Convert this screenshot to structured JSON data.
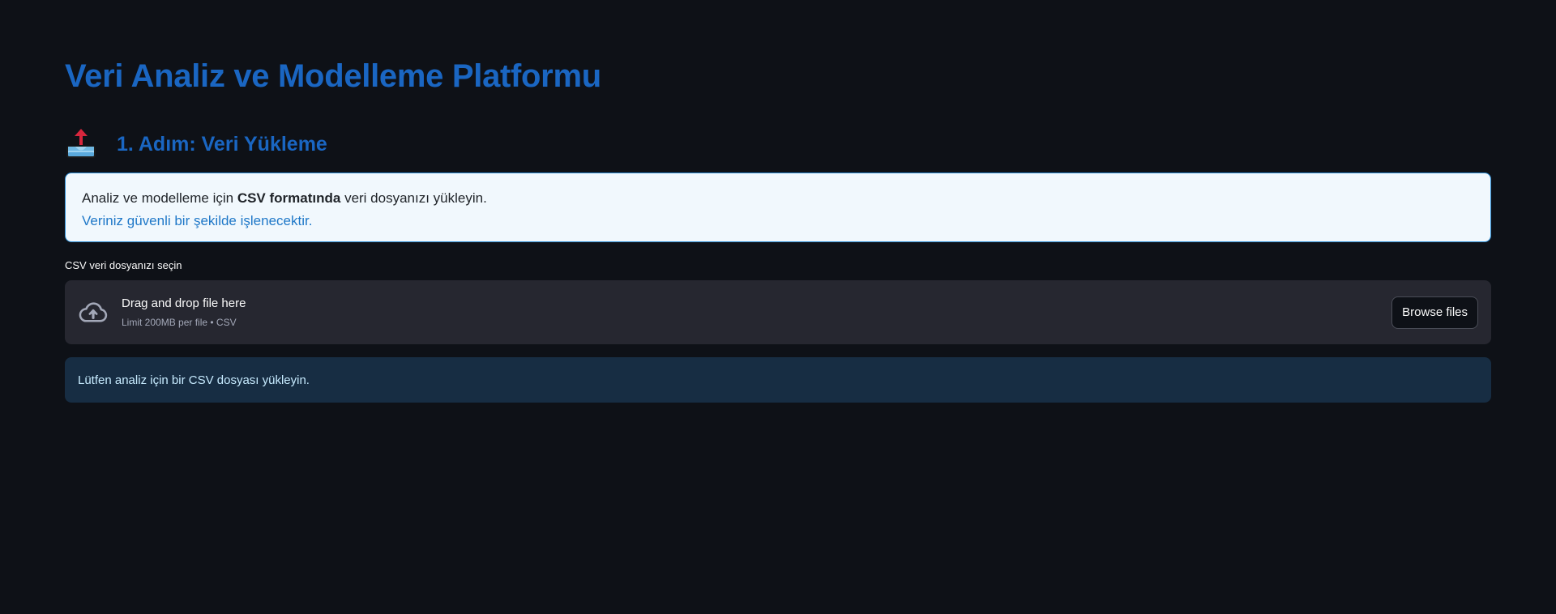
{
  "header": {
    "title": "Veri Analiz ve Modelleme Platformu"
  },
  "step1": {
    "icon": "inbox-upload-icon",
    "title": "1. Adım: Veri Yükleme"
  },
  "info_card": {
    "line1_prefix": "Analiz ve modelleme için ",
    "line1_bold": "CSV formatında",
    "line1_suffix": " veri dosyanızı yükleyin.",
    "line2": "Veriniz güvenli bir şekilde işlenecektir."
  },
  "uploader": {
    "label": "CSV veri dosyanızı seçin",
    "icon": "cloud-upload-icon",
    "drop_text": "Drag and drop file here",
    "limit_text": "Limit 200MB per file • CSV",
    "button_label": "Browse files"
  },
  "alert": {
    "message": "Lütfen analiz için bir CSV dosyası yükleyin."
  },
  "colors": {
    "background": "#0e1117",
    "heading_blue": "#1a66c2",
    "info_border": "#2e8fd6",
    "info_bg": "#f1f8fd",
    "dropzone_bg": "#262730",
    "alert_bg": "#172d43",
    "alert_text": "#c7ebff"
  }
}
